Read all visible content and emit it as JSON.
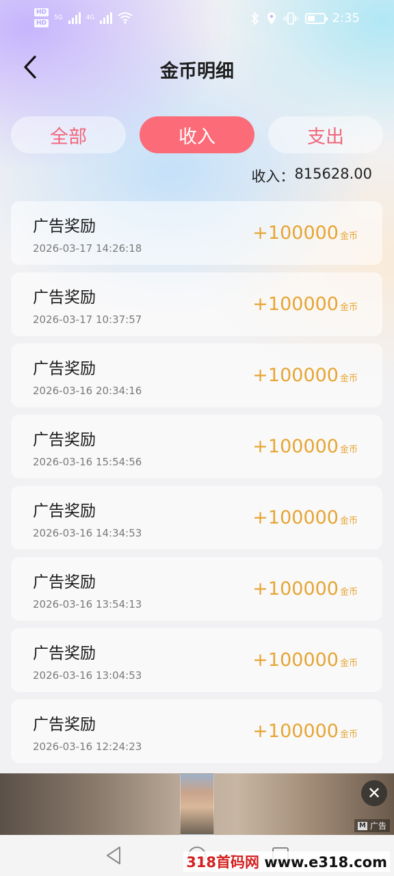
{
  "status_bar": {
    "network_badges": [
      "HD",
      "HD"
    ],
    "network_type_1": "5G",
    "network_type_2": "4G",
    "time": "2:35"
  },
  "header": {
    "title": "金币明细"
  },
  "tabs": [
    {
      "label": "全部",
      "active": false
    },
    {
      "label": "收入",
      "active": true
    },
    {
      "label": "支出",
      "active": false
    }
  ],
  "summary": {
    "label": "收入：",
    "value": "815628.00"
  },
  "records": [
    {
      "title": "广告奖励",
      "time": "2026-03-17 14:26:18",
      "amount": "+100000",
      "unit": "金币"
    },
    {
      "title": "广告奖励",
      "time": "2026-03-17 10:37:57",
      "amount": "+100000",
      "unit": "金币"
    },
    {
      "title": "广告奖励",
      "time": "2026-03-16 20:34:16",
      "amount": "+100000",
      "unit": "金币"
    },
    {
      "title": "广告奖励",
      "time": "2026-03-16 15:54:56",
      "amount": "+100000",
      "unit": "金币"
    },
    {
      "title": "广告奖励",
      "time": "2026-03-16 14:34:53",
      "amount": "+100000",
      "unit": "金币"
    },
    {
      "title": "广告奖励",
      "time": "2026-03-16 13:54:13",
      "amount": "+100000",
      "unit": "金币"
    },
    {
      "title": "广告奖励",
      "time": "2026-03-16 13:04:53",
      "amount": "+100000",
      "unit": "金币"
    },
    {
      "title": "广告奖励",
      "time": "2026-03-16 12:24:23",
      "amount": "+100000",
      "unit": "金币"
    }
  ],
  "ad": {
    "label": "广告",
    "close_glyph": "✕"
  },
  "watermark": {
    "prefix": "318首码网",
    "url": "www.e318.com"
  },
  "colors": {
    "accent": "#fb6b78",
    "amount": "#e6a533"
  }
}
